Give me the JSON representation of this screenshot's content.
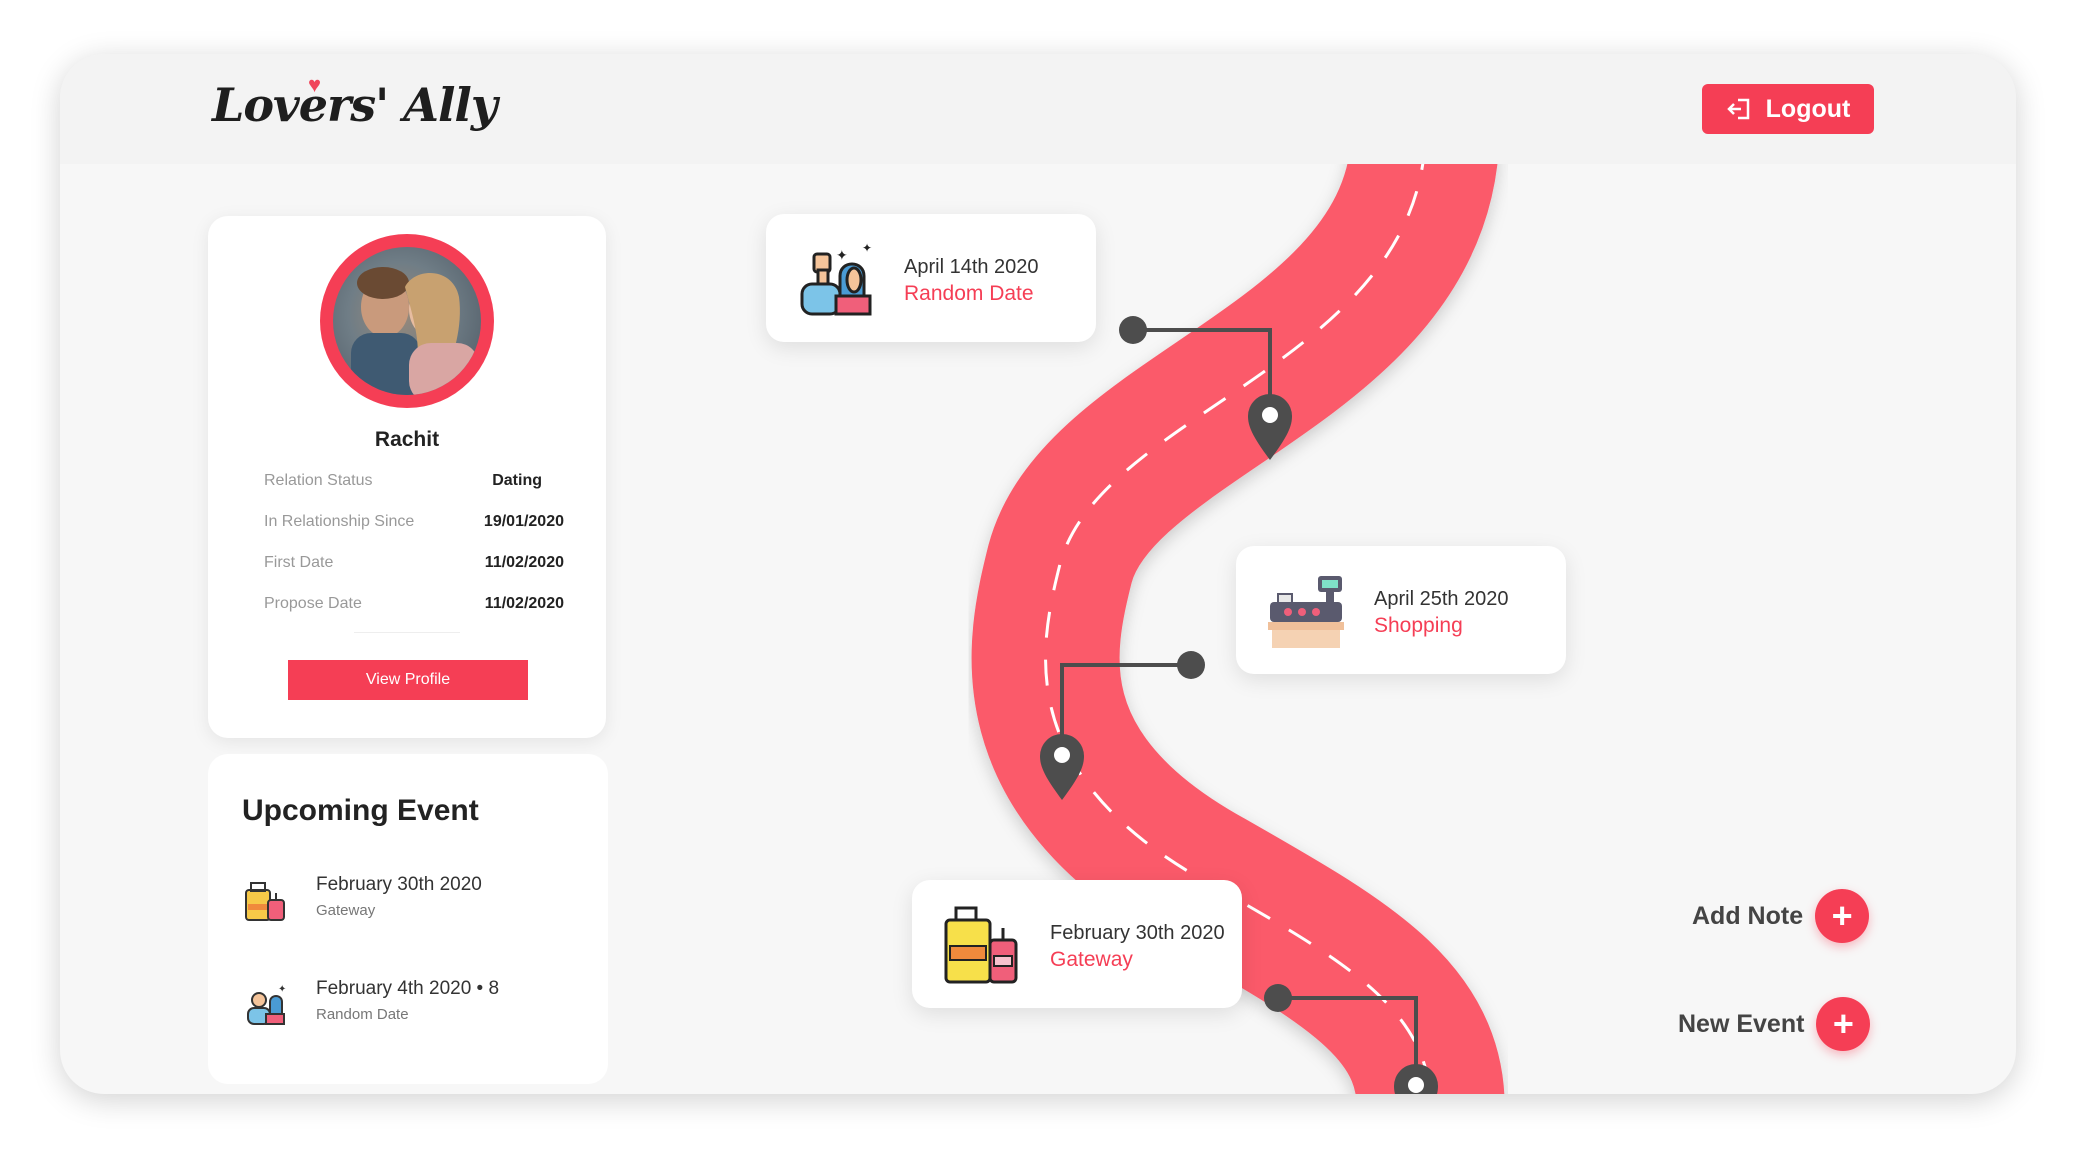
{
  "brand": {
    "logo_text": "Lovers' Ally"
  },
  "header": {
    "logout_label": "Logout"
  },
  "profile": {
    "name": "Rachit",
    "rows": [
      {
        "label": "Relation Status",
        "value": "Dating"
      },
      {
        "label": "In Relationship Since",
        "value": "19/01/2020"
      },
      {
        "label": "First Date",
        "value": "11/02/2020"
      },
      {
        "label": "Propose Date",
        "value": "11/02/2020"
      }
    ],
    "view_label": "View Profile"
  },
  "upcoming": {
    "title": "Upcoming Event",
    "items": [
      {
        "date": "February 30th 2020",
        "sub": "Gateway",
        "icon": "luggage-icon"
      },
      {
        "date": "February 4th 2020 • 8",
        "sub": "Random Date",
        "icon": "couple-icon"
      }
    ]
  },
  "timeline": [
    {
      "date": "April 14th 2020",
      "type": "Random Date",
      "icon": "couple-icon"
    },
    {
      "date": "April 25th 2020",
      "type": "Shopping",
      "icon": "cash-register-icon"
    },
    {
      "date": "February 30th 2020",
      "type": "Gateway",
      "icon": "luggage-icon"
    }
  ],
  "actions": {
    "add_note": "Add Note",
    "new_event": "New Event"
  },
  "colors": {
    "accent": "#f53e55",
    "road": "#fb5a6b",
    "background": "#f7f7f7"
  }
}
